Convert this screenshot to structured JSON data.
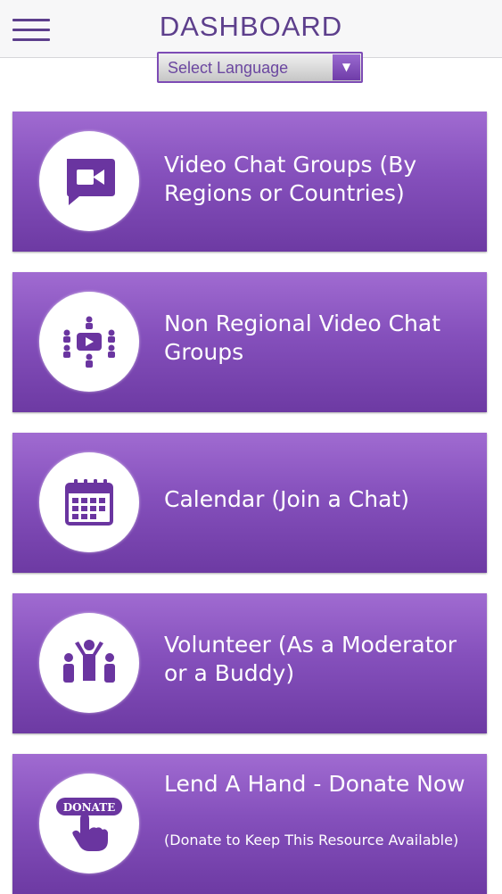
{
  "header": {
    "title": "DASHBOARD",
    "menu_icon": "hamburger-menu-icon"
  },
  "language_select": {
    "selected": "Select Language"
  },
  "tiles": [
    {
      "label": "Video Chat Groups (By Regions or Countries)",
      "icon": "video-chat-icon"
    },
    {
      "label": "Non Regional Video Chat Groups",
      "icon": "group-video-icon"
    },
    {
      "label": "Calendar (Join a Chat)",
      "icon": "calendar-icon"
    },
    {
      "label": "Volunteer (As a Moderator or a Buddy)",
      "icon": "volunteer-people-icon"
    },
    {
      "label": "Lend A Hand - Donate Now",
      "sublabel": "(Donate to Keep This Resource Available)",
      "icon": "donate-button-icon",
      "icon_text": "DONATE"
    }
  ],
  "colors": {
    "brand_purple": "#5d3f8c",
    "tile_top": "#a06bd1",
    "tile_bottom": "#6d3aa3",
    "icon_purple": "#6a35a0"
  }
}
